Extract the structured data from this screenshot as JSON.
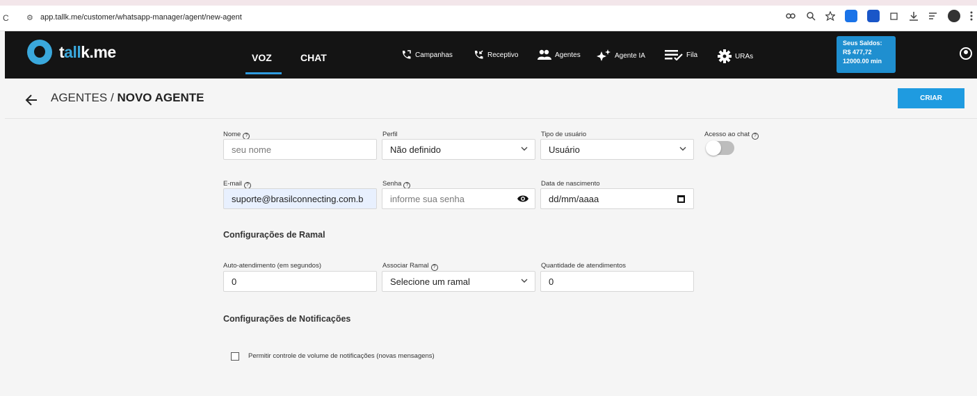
{
  "browser": {
    "url": "app.tallk.me/customer/whatsapp-manager/agent/new-agent",
    "reload_glyph": "C",
    "site_icon_glyph": "⚙",
    "icons": [
      "key-icon",
      "zoom-icon",
      "star-icon",
      "extension-icon",
      "download-icon",
      "queue-icon",
      "profile-icon",
      "menu-icon"
    ]
  },
  "nav": {
    "logo": {
      "pre": "t",
      "accent": "all",
      "post": "k.me"
    },
    "tabs": [
      {
        "label": "VOZ",
        "active": true
      },
      {
        "label": "CHAT",
        "active": false
      }
    ],
    "menu": [
      {
        "label": "Campanhas",
        "icon": "phone-outgoing-icon"
      },
      {
        "label": "Receptivo",
        "icon": "phone-incoming-icon"
      },
      {
        "label": "Agentes",
        "icon": "users-icon"
      },
      {
        "label": "Agente IA",
        "icon": "sparkles-icon"
      },
      {
        "label": "Fila",
        "icon": "list-check-icon"
      },
      {
        "label": "URAs",
        "icon": "gear-icon"
      }
    ],
    "saldo": {
      "title": "Seus Saldos:",
      "money": "R$ 477,72",
      "minutes": "12000.00 min"
    }
  },
  "header": {
    "crumb_parent": "AGENTES",
    "separator": "/",
    "crumb_current": "NOVO AGENTE",
    "create_label": "CRIAR"
  },
  "form": {
    "nome": {
      "label": "Nome",
      "placeholder": "seu nome"
    },
    "perfil": {
      "label": "Perfil",
      "value": "Não definido"
    },
    "tipo": {
      "label": "Tipo de usuário",
      "value": "Usuário"
    },
    "acesso": {
      "label": "Acesso ao chat",
      "enabled": false
    },
    "email": {
      "label": "E-mail",
      "value": "suporte@brasilconnecting.com.b"
    },
    "senha": {
      "label": "Senha",
      "placeholder": "informe sua senha"
    },
    "nascimento": {
      "label": "Data de nascimento",
      "placeholder": "dd/mm/aaaa"
    }
  },
  "ramal": {
    "title": "Configurações de Ramal",
    "auto": {
      "label": "Auto-atendimento (em segundos)",
      "value": "0"
    },
    "associar": {
      "label": "Associar Ramal",
      "value": "Selecione um ramal"
    },
    "quantidade": {
      "label": "Quantidade de atendimentos",
      "value": "0"
    }
  },
  "notificacoes": {
    "title": "Configurações de Notificações",
    "volume_label": "Permitir controle de volume de notificações (novas mensagens)",
    "volume_checked": false
  },
  "colors": {
    "accent": "#1f9be0",
    "nav_bg": "#141414",
    "logo_accent": "#3aa8dc"
  }
}
